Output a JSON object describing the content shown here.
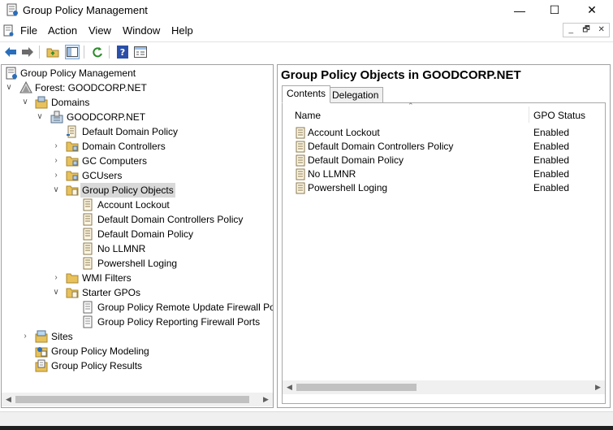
{
  "window": {
    "title": "Group Policy Management",
    "controls": {
      "minimize": "—",
      "maximize": "☐",
      "close": "✕"
    }
  },
  "menu": {
    "items": [
      "File",
      "Action",
      "View",
      "Window",
      "Help"
    ],
    "mdi_buttons": [
      "_",
      "🗗",
      "✕"
    ]
  },
  "toolbar": {
    "buttons": [
      "back-icon",
      "forward-icon",
      "up-folder-icon",
      "show-hide-tree-icon",
      "refresh-icon",
      "help-icon",
      "properties-icon"
    ]
  },
  "tree": {
    "root": "Group Policy Management",
    "forest": "Forest: GOODCORP.NET",
    "domains": "Domains",
    "domain": "GOODCORP.NET",
    "default_domain_policy": "Default Domain Policy",
    "domain_controllers": "Domain Controllers",
    "gc_computers": "GC Computers",
    "gcusers": "GCUsers",
    "gpo_container": "Group Policy Objects",
    "gpos": [
      "Account Lockout",
      "Default Domain Controllers Policy",
      "Default Domain Policy",
      "No LLMNR",
      "Powershell Loging"
    ],
    "wmi_filters": "WMI Filters",
    "starter_gpos": "Starter GPOs",
    "starter_items": [
      "Group Policy Remote Update Firewall Ports",
      "Group Policy Reporting Firewall Ports"
    ],
    "sites": "Sites",
    "modeling": "Group Policy Modeling",
    "results": "Group Policy Results"
  },
  "details": {
    "header": "Group Policy Objects in GOODCORP.NET",
    "tabs": [
      "Contents",
      "Delegation"
    ],
    "columns": {
      "name": "Name",
      "status": "GPO Status"
    },
    "rows": [
      {
        "name": "Account Lockout",
        "status": "Enabled"
      },
      {
        "name": "Default Domain Controllers Policy",
        "status": "Enabled"
      },
      {
        "name": "Default Domain Policy",
        "status": "Enabled"
      },
      {
        "name": "No LLMNR",
        "status": "Enabled"
      },
      {
        "name": "Powershell Loging",
        "status": "Enabled"
      }
    ]
  },
  "colors": {
    "selection": "#d9d9d9",
    "folder": "#e8c15a",
    "accent_blue": "#2a6ebb",
    "pane_border": "#a0a0a0"
  }
}
